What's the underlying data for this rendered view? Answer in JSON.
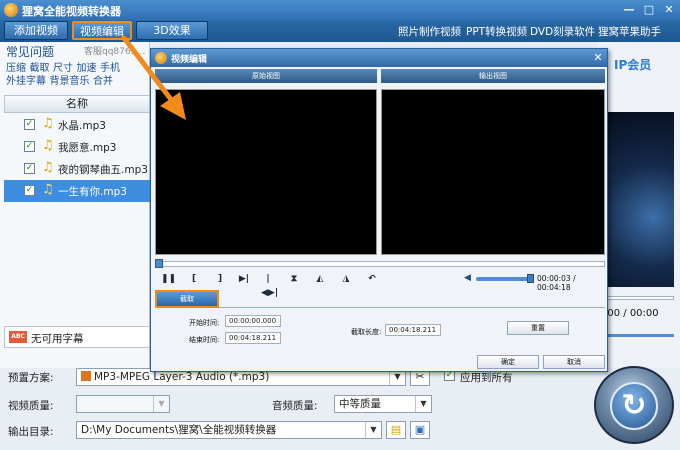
{
  "app": {
    "title": "狸窝全能视频转换器",
    "window_controls": [
      "—",
      "□",
      "✕"
    ]
  },
  "toolbar": {
    "buttons": [
      "添加视频",
      "视频编辑",
      "3D效果"
    ],
    "links": [
      "照片制作视频",
      "PPT转换视频",
      "DVD刻录软件",
      "狸窝苹果助手"
    ]
  },
  "left_panel": {
    "faq_title": "常见问题",
    "service_text": "客服qq8763…",
    "quick_links_row1": [
      "压缩",
      "截取",
      "尺寸",
      "加速",
      "手机"
    ],
    "quick_links_row2": [
      "外挂字幕",
      "背景音乐",
      "合并"
    ],
    "column_header": "名称",
    "files": [
      {
        "name": "水晶.mp3",
        "checked": true,
        "selected": false
      },
      {
        "name": "我愿意.mp3",
        "checked": true,
        "selected": false
      },
      {
        "name": "夜的钢琴曲五.mp3",
        "checked": true,
        "selected": false
      },
      {
        "name": "一生有你.mp3",
        "checked": true,
        "selected": true
      }
    ],
    "subtitle_label": "无可用字幕",
    "subtitle_icon_text": "ABC"
  },
  "right_panel": {
    "vip_text": "IP会员",
    "time_text": ":00 / 00:00"
  },
  "bottom": {
    "preset_label": "预置方案:",
    "preset_value": "MP3-MPEG Layer-3 Audio (*.mp3)",
    "apply_all_label": "应用到所有",
    "apply_all_checked": true,
    "video_quality_label": "视频质量:",
    "video_quality_value": "",
    "audio_quality_label": "音频质量:",
    "audio_quality_value": "中等质量",
    "output_label": "输出目录:",
    "output_value": "D:\\My Documents\\狸窝\\全能视频转换器"
  },
  "dialog": {
    "title": "视频编辑",
    "original_view_label": "原始视图",
    "output_view_label": "输出视图",
    "time_display": "00:00:03 / 00:04:18",
    "tab_cut": "截取",
    "start_time_label": "开始时间:",
    "start_time_value": "00:00:00.000",
    "end_time_label": "结束时间:",
    "end_time_value": "00:04:18.211",
    "cut_length_label": "截取长度:",
    "cut_length_value": "00:04:18.211",
    "reset_button": "重置",
    "ok_button": "确定",
    "cancel_button": "取消",
    "controls": [
      "❚❚",
      "[",
      "]",
      "▶|",
      "|◀▶|",
      "⧗",
      "◭",
      "◮",
      "↶"
    ]
  },
  "colors": {
    "accent_orange": "#f28a1c",
    "toolbar_blue": "#2a6aa8",
    "selection_blue": "#3d8de0"
  }
}
